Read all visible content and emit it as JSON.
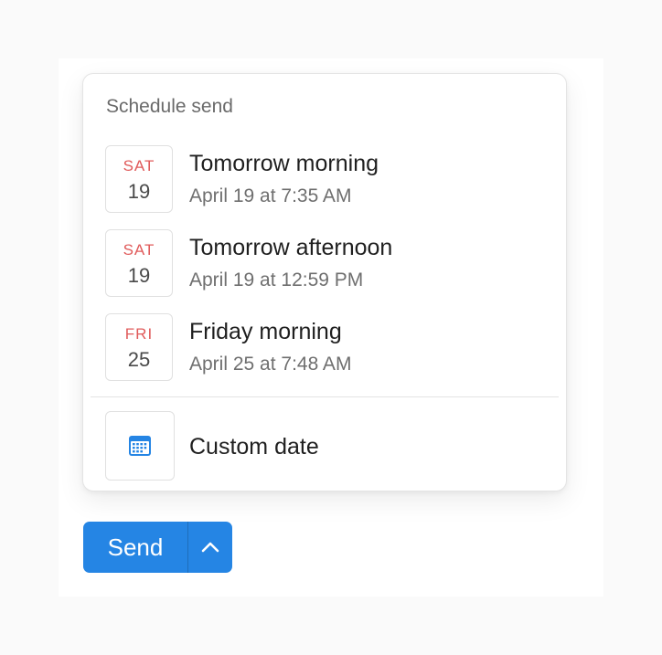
{
  "popover": {
    "title": "Schedule send",
    "options": [
      {
        "day": "SAT",
        "date": "19",
        "label": "Tomorrow morning",
        "when": "April 19 at 7:35 AM"
      },
      {
        "day": "SAT",
        "date": "19",
        "label": "Tomorrow afternoon",
        "when": "April 19 at 12:59 PM"
      },
      {
        "day": "FRI",
        "date": "25",
        "label": "Friday morning",
        "when": "April 25 at 7:48 AM"
      }
    ],
    "custom": {
      "label": "Custom date",
      "icon": "calendar-icon"
    }
  },
  "composer": {
    "send_label": "Send",
    "schedule_icon": "chevron-up-icon"
  },
  "colors": {
    "accent": "#2585e4",
    "day_label": "#e05a5a",
    "calendar_icon": "#2585e4"
  }
}
